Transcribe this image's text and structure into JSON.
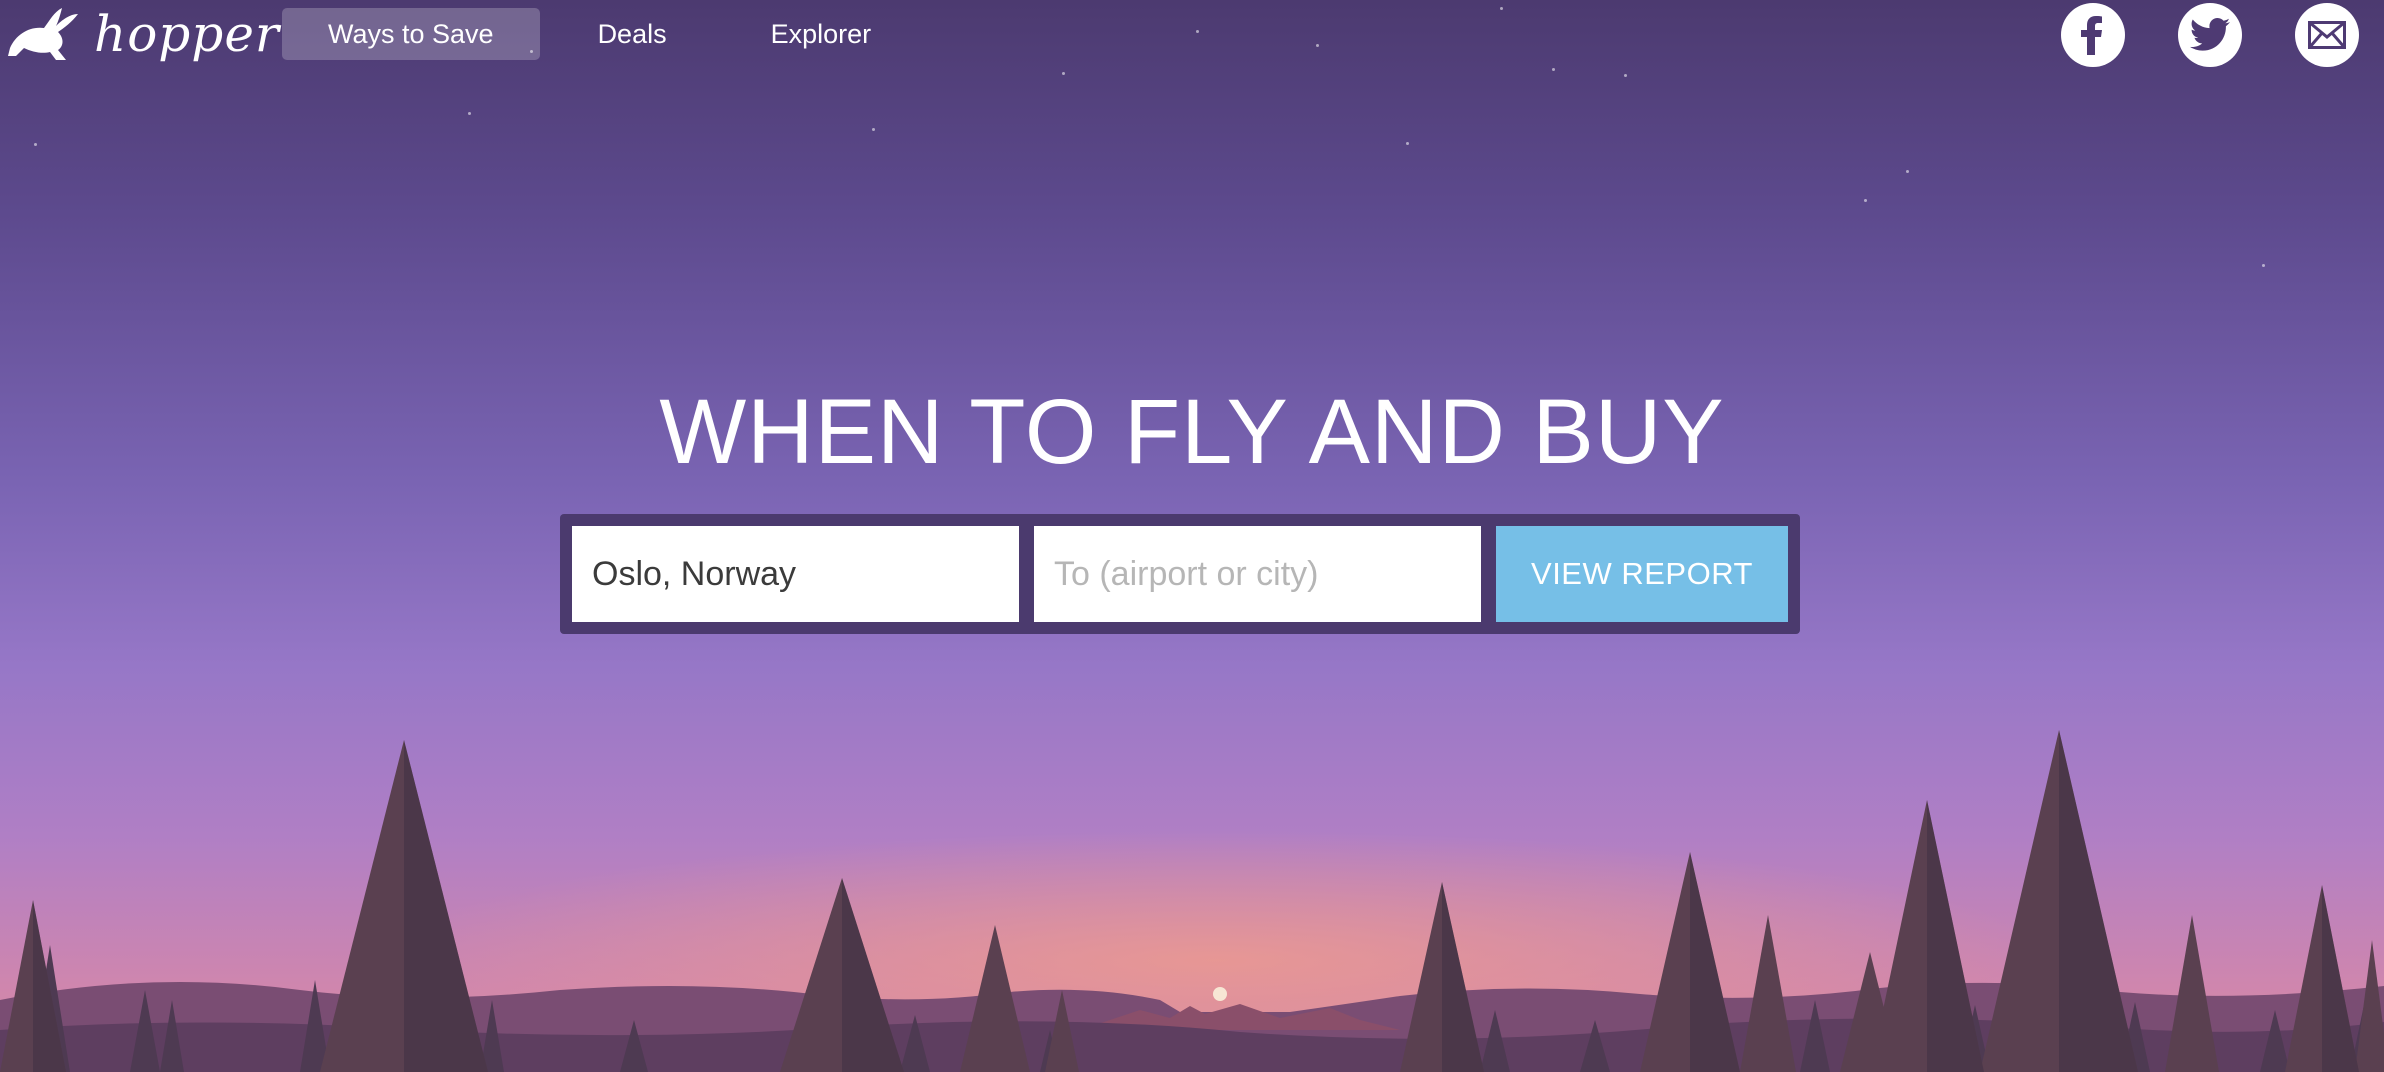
{
  "header": {
    "logo_text": "hopper",
    "nav": [
      {
        "label": "Ways to Save",
        "active": true
      },
      {
        "label": "Deals",
        "active": false
      },
      {
        "label": "Explorer",
        "active": false
      }
    ],
    "social": [
      {
        "icon": "facebook-icon"
      },
      {
        "icon": "twitter-icon"
      },
      {
        "icon": "email-icon"
      }
    ]
  },
  "hero": {
    "title": "WHEN TO FLY AND BUY",
    "from_value": "Oslo, Norway",
    "to_placeholder": "To (airport or city)",
    "button_label": "VIEW REPORT"
  },
  "colors": {
    "button": "#76bfe7",
    "search_frame": "#4b3a6e",
    "sky_top": "#4c3a70",
    "sky_bottom": "#d98f9a"
  }
}
